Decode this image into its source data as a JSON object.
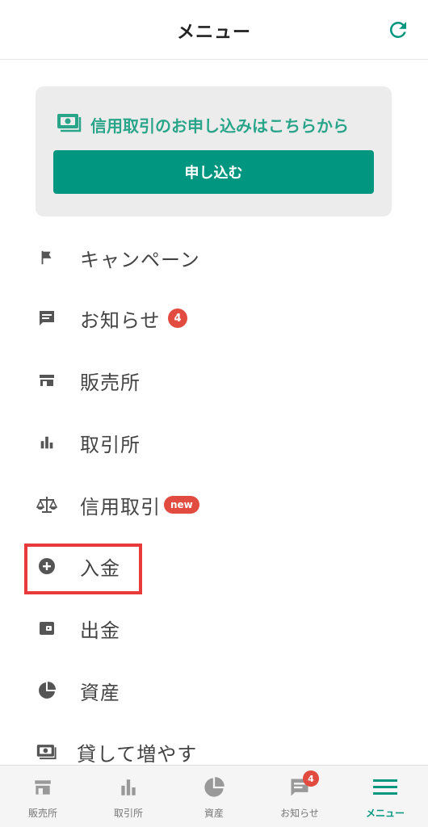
{
  "header": {
    "title": "メニュー",
    "refresh_icon": "refresh-icon"
  },
  "promo": {
    "text": "信用取引のお申し込みはこちらから",
    "button_label": "申し込む",
    "icon": "cash-icon"
  },
  "menu": {
    "items": [
      {
        "label": "キャンペーン",
        "icon": "flag-icon"
      },
      {
        "label": "お知らせ",
        "icon": "message-icon",
        "badge": "4"
      },
      {
        "label": "販売所",
        "icon": "store-icon"
      },
      {
        "label": "取引所",
        "icon": "bar-chart-icon"
      },
      {
        "label": "信用取引",
        "icon": "scale-icon",
        "badge": "new"
      },
      {
        "label": "入金",
        "icon": "plus-circle-icon"
      },
      {
        "label": "出金",
        "icon": "wallet-icon"
      },
      {
        "label": "資産",
        "icon": "pie-chart-icon"
      },
      {
        "label": "貸して増やす",
        "icon": "cash-icon"
      }
    ]
  },
  "tabbar": {
    "tabs": [
      {
        "label": "販売所",
        "icon": "store-icon"
      },
      {
        "label": "取引所",
        "icon": "bar-chart-icon"
      },
      {
        "label": "資産",
        "icon": "pie-chart-icon"
      },
      {
        "label": "お知らせ",
        "icon": "message-icon",
        "badge": "4"
      },
      {
        "label": "メニュー",
        "icon": "menu-icon",
        "active": true
      }
    ]
  },
  "colors": {
    "accent": "#00967f",
    "badge": "#e24b3f",
    "highlight": "#e83a3a"
  }
}
